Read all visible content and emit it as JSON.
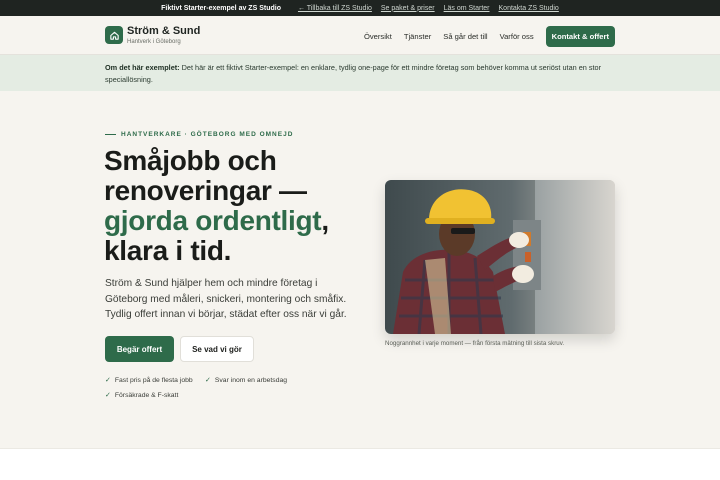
{
  "topbar": {
    "brand": "Fiktivt Starter-exempel av ZS Studio",
    "links": [
      "← Tillbaka till ZS Studio",
      "Se paket & priser",
      "Läs om Starter",
      "Kontakta ZS Studio"
    ]
  },
  "header": {
    "brand_name": "Ström & Sund",
    "brand_sub": "Hantverk i Göteborg",
    "nav": [
      "Översikt",
      "Tjänster",
      "Så går det till",
      "Varför oss"
    ],
    "cta": "Kontakt & offert"
  },
  "notice": {
    "label": "Om det här exemplet:",
    "text": " Det här är ett fiktivt Starter-exempel: en enklare, tydlig one-page för ett mindre företag som behöver komma ut seriöst utan en stor speciallösning."
  },
  "hero": {
    "eyebrow": "HANTVERKARE · GÖTEBORG MED OMNEJD",
    "headline_line1": "Småjobb och",
    "headline_line2": "renoveringar —",
    "headline_accent": "gjorda ordentligt",
    "headline_comma": ",",
    "headline_line4": "klara i tid.",
    "lede": "Ström & Sund hjälper hem och mindre företag i Göteborg med måleri, snickeri, montering och småfix. Tydlig offert innan vi börjar, städat efter oss när vi går.",
    "primary_button": "Begär offert",
    "secondary_button": "Se vad vi gör",
    "features": [
      "Fast pris på de flesta jobb",
      "Svar inom en arbetsdag",
      "Försäkrade & F-skatt"
    ],
    "check_glyph": "✓",
    "image_caption": "Noggrannhet i varje moment — från första mätning till sista skruv."
  },
  "colors": {
    "accent": "#2e6b4a",
    "background": "#f6f4ef",
    "topbar": "#1f2421",
    "notice": "#e4ece3"
  },
  "icons": {
    "logo": "home-icon"
  }
}
